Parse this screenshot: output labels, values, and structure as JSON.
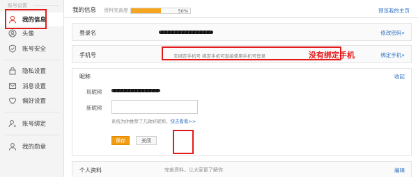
{
  "sidebar": {
    "title": "账号设置",
    "items": [
      {
        "label": "我的信息",
        "icon": "user-icon"
      },
      {
        "label": "头像",
        "icon": "avatar-icon"
      },
      {
        "label": "账号安全",
        "icon": "shield-icon"
      },
      {
        "label": "隐私设置",
        "icon": "lock-icon"
      },
      {
        "label": "消息设置",
        "icon": "message-icon"
      },
      {
        "label": "偏好设置",
        "icon": "heart-icon"
      },
      {
        "label": "账号绑定",
        "icon": "user-link-icon"
      },
      {
        "label": "我的勋章",
        "icon": "medal-icon"
      }
    ]
  },
  "header": {
    "title": "我的信息",
    "completion_label": "资料完善度",
    "completion_percent": 50,
    "completion_text": "50%",
    "home_link": "预览我的主页"
  },
  "login_row": {
    "label": "登录名",
    "action": "修改密码»"
  },
  "phone_row": {
    "label": "手机号",
    "text": "未绑定手机号 绑定手机可直接使用手机号登录",
    "annotation": "没有绑定手机",
    "action": "绑定手机»"
  },
  "nickname_panel": {
    "label": "昵称",
    "collapse": "收起",
    "current_label": "现昵称",
    "new_label": "新昵称",
    "new_value": "",
    "hint": "系统为你推荐了几款好昵称，",
    "hint_link": "快去看看>>",
    "save": "保存",
    "close": "关闭"
  },
  "profile_row": {
    "label": "个人资料",
    "summary": "完善资料，让大家更了解你",
    "action": "编辑"
  },
  "colors": {
    "accent": "#2f72c4",
    "progress": "#f6a521",
    "save_button": "#f39c12",
    "annotation_red": "#e41a1a"
  }
}
